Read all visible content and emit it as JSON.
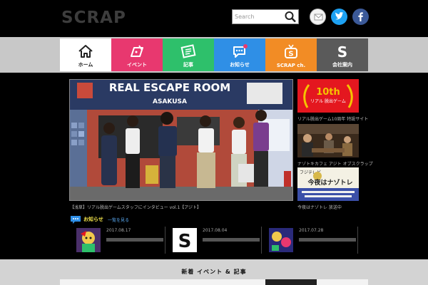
{
  "header": {
    "logo": "SCRAP",
    "search_placeholder": "Search"
  },
  "nav": [
    {
      "label": "ホーム",
      "color": "#ffffff",
      "icon": "home-icon"
    },
    {
      "label": "イベント",
      "color": "#e8386f",
      "icon": "ticket-icon"
    },
    {
      "label": "記事",
      "color": "#2ec06b",
      "icon": "newspaper-icon"
    },
    {
      "label": "お知らせ",
      "color": "#2f8fe6",
      "icon": "speech-bubble-icon"
    },
    {
      "label": "SCRAP ch.",
      "color": "#f28c25",
      "icon": "channel-s-icon"
    },
    {
      "label": "会社案内",
      "color": "#5a5a5a",
      "icon": "s-letter-icon"
    }
  ],
  "hero": {
    "sign_title": "REAL ESCAPE ROOM",
    "sign_subtitle": "ASAKUSA",
    "caption": "【浅草】リアル脱出ゲームスタッフにインタビュー vol.1【アジト】"
  },
  "side": {
    "banner1_big": "10th",
    "banner1_small": "リアル\n脱出ゲーム",
    "banner1_caption": "リアル脱出ゲーム10周年 特設サイト",
    "banner2_caption": "ナゾトキカフェ アジト オブスクラップ",
    "banner3_top": "フジテレビ",
    "banner3_title": "今夜はナゾトレ",
    "banner3_caption": "今夜はナゾトレ 放送中"
  },
  "news": {
    "heading": "お知らせ",
    "more": "一覧を見る",
    "items": [
      {
        "date": "2017.08.17",
        "thumb": "anime-character-thumbnail"
      },
      {
        "date": "2017.08.04",
        "thumb": "s-logo-thumbnail"
      },
      {
        "date": "2017.07.28",
        "thumb": "comic-art-thumbnail"
      }
    ]
  },
  "bottom": {
    "title": "新着 イベント & 記事"
  }
}
